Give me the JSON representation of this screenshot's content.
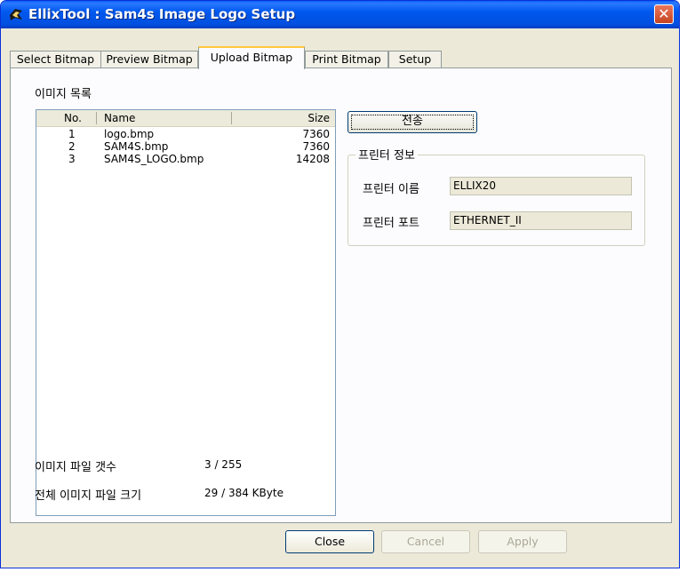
{
  "window": {
    "title": "EllixTool : Sam4s Image Logo Setup",
    "close_glyph": "✕"
  },
  "tabs": [
    {
      "label": "Select Bitmap",
      "active": false
    },
    {
      "label": "Preview Bitmap",
      "active": false
    },
    {
      "label": "Upload Bitmap",
      "active": true
    },
    {
      "label": "Print Bitmap",
      "active": false
    },
    {
      "label": "Setup",
      "active": false
    }
  ],
  "image_list": {
    "label": "이미지 목록",
    "columns": {
      "no": "No.",
      "name": "Name",
      "size": "Size"
    },
    "rows": [
      {
        "no": "1",
        "name": "logo.bmp",
        "size": "7360"
      },
      {
        "no": "2",
        "name": "SAM4S.bmp",
        "size": "7360"
      },
      {
        "no": "3",
        "name": "SAM4S_LOGO.bmp",
        "size": "14208"
      }
    ]
  },
  "send_button": "전송",
  "printer_info": {
    "group_title": "프린터 정보",
    "name_label": "프린터 이름",
    "name_value": "ELLIX20",
    "port_label": "프린터 포트",
    "port_value": "ETHERNET_II"
  },
  "stats": {
    "file_count_label": "이미지 파일 갯수",
    "file_count_value": "3 / 255",
    "file_size_label": "전체 이미지 파일 크기",
    "file_size_value": "29 / 384 KByte"
  },
  "buttons": {
    "close": "Close",
    "cancel": "Cancel",
    "apply": "Apply"
  },
  "colors": {
    "titlebar": "#0058ee",
    "active_tab_accent": "#ffc83c",
    "dialog_bg": "#ece9d8"
  }
}
